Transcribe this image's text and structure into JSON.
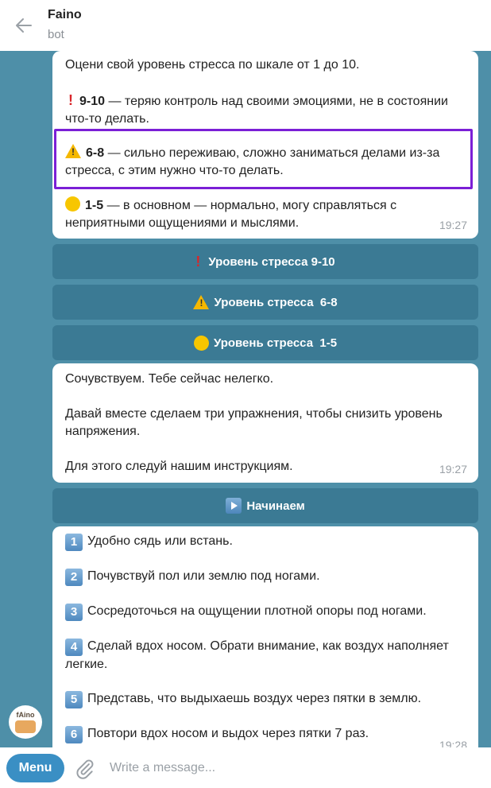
{
  "header": {
    "title": "Faino",
    "subtitle": "bot"
  },
  "messages": [
    {
      "intro": "Оцени свой уровень стресса по шкале от 1 до 10.",
      "items": [
        {
          "icon": "red-exclamation-icon",
          "range": "9-10",
          "text": " — теряю контроль над своими эмоциями, не в состоянии что-то делать."
        },
        {
          "icon": "warning-icon",
          "range": "6-8",
          "text": " — сильно переживаю, сложно заниматься делами из-за стресса, с этим нужно что-то делать."
        },
        {
          "icon": "yellow-circle-icon",
          "range": "1-5",
          "text": " — в основном — нормально, могу справляться с неприятными ощущениями и мыслями."
        }
      ],
      "time": "19:27"
    },
    {
      "lines": [
        "Сочувствуем. Тебе сейчас нелегко.",
        "Давай вместе сделаем три упражнения, чтобы снизить уровень напряжения.",
        "Для этого следуй нашим инструкциям."
      ],
      "time": "19:27"
    },
    {
      "steps": [
        {
          "n": "1",
          "text": "Удобно сядь или встань."
        },
        {
          "n": "2",
          "text": "Почувствуй пол или землю под ногами."
        },
        {
          "n": "3",
          "text": "Сосредоточься на ощущении плотной опоры под ногами."
        },
        {
          "n": "4",
          "text": "Сделай вдох носом. Обрати внимание, как воздух наполняет легкие."
        },
        {
          "n": "5",
          "text": "Представь, что выдыхаешь воздух через пятки в землю."
        },
        {
          "n": "6",
          "text": "Повтори вдох носом и выдох через пятки 7 раз."
        }
      ],
      "time": "19:28"
    }
  ],
  "keyboard_buttons": [
    {
      "icon": "red-exclamation-icon",
      "label": "Уровень стресса 9-10"
    },
    {
      "icon": "warning-icon",
      "label": "Уровень стресса  6-8"
    },
    {
      "icon": "yellow-circle-icon",
      "label": "Уровень стресса  1-5"
    },
    {
      "icon": "play-icon",
      "label": "Начинаем"
    }
  ],
  "avatar": {
    "text": "fAino"
  },
  "footer": {
    "menu_label": "Menu",
    "input_placeholder": "Write a message..."
  },
  "colors": {
    "chat_bg": "#4e8fa8",
    "button_bg": "#3b7a94",
    "menu_bg": "#3a8fc4",
    "highlight": "#7b1fd6"
  }
}
